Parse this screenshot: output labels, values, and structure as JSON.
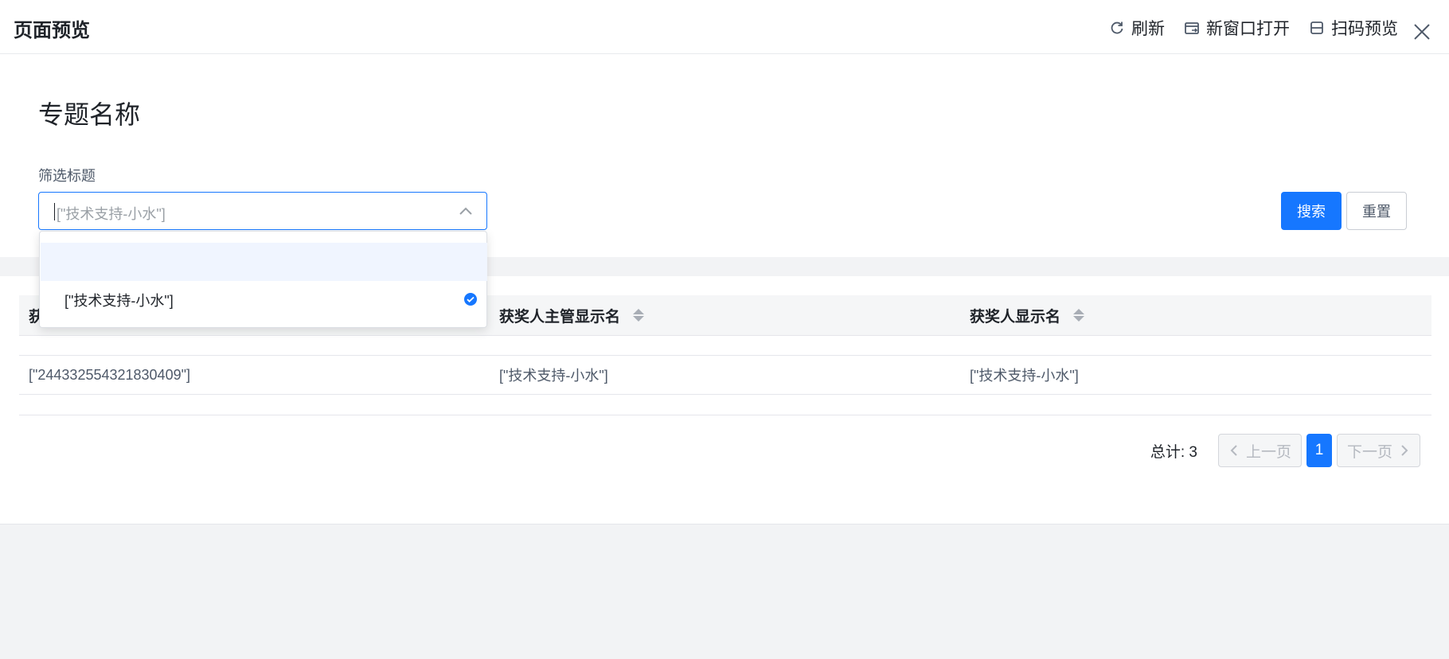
{
  "topbar": {
    "title": "页面预览",
    "actions": [
      {
        "label": "刷新",
        "icon": "refresh-icon"
      },
      {
        "label": "新窗口打开",
        "icon": "new-window-icon"
      },
      {
        "label": "扫码预览",
        "icon": "qrcode-icon"
      }
    ],
    "close_icon": "close-icon"
  },
  "page": {
    "heading": "专题名称",
    "filter_label": "筛选标题",
    "select_placeholder": "[\"技术支持-小水\"]",
    "search_label": "搜索",
    "reset_label": "重置"
  },
  "dropdown": {
    "options": [
      {
        "label": "",
        "selected": false
      },
      {
        "label": "[\"技术支持-小水\"]",
        "selected": true
      }
    ]
  },
  "table": {
    "columns": [
      "获",
      "获奖人主管显示名",
      "获奖人显示名"
    ],
    "rows": [
      [
        "[\"244332554321830409\"]",
        "[\"技术支持-小水\"]",
        "[\"技术支持-小水\"]"
      ]
    ]
  },
  "pagination": {
    "total": "总计: 3",
    "prev": "上一页",
    "current": "1",
    "next": "下一页"
  },
  "colors": {
    "primary": "#1677ff",
    "page_gray": "#f2f3f5",
    "header_bg": "#f5f6f7"
  }
}
